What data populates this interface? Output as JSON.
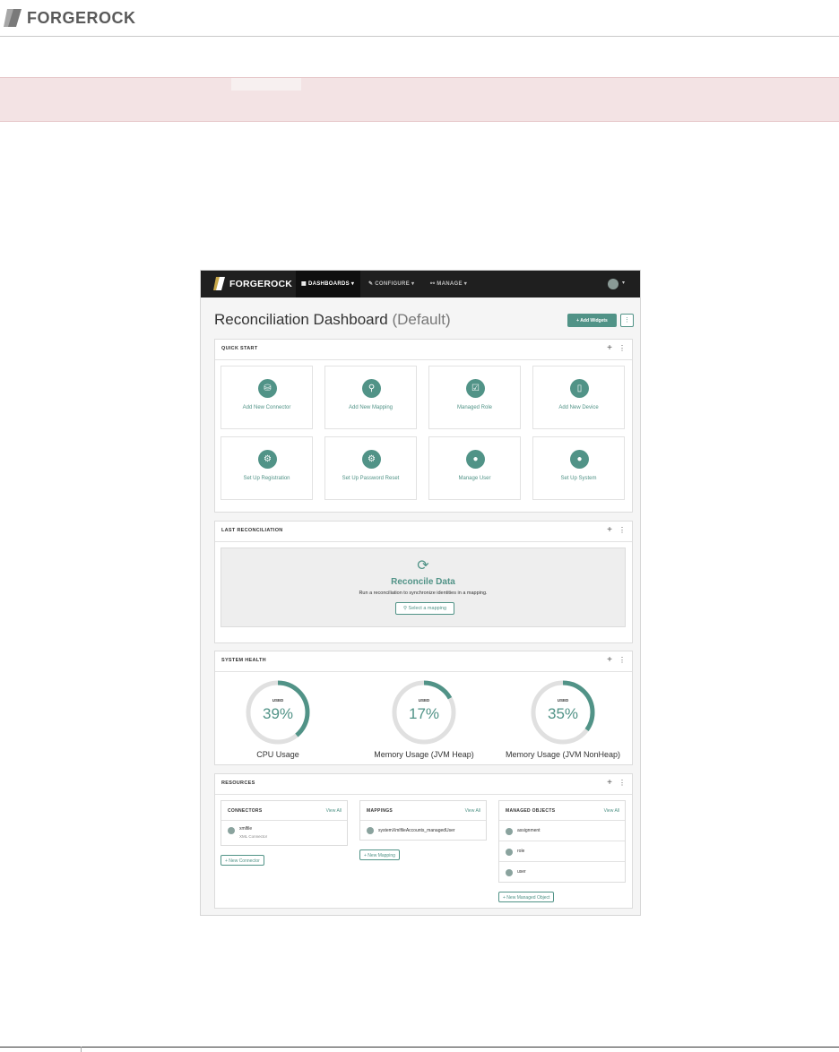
{
  "doc": {
    "logo_text": "FORGEROCK"
  },
  "app": {
    "logo_text": "FORGEROCK",
    "nav": {
      "dashboards": "DASHBOARDS ▾",
      "configure": "CONFIGURE ▾",
      "manage": "MANAGE ▾"
    },
    "user_caret": "▾"
  },
  "dashboard": {
    "title": "Reconciliation Dashboard",
    "title_suffix": "(Default)",
    "add_widgets_label": "+ Add Widgets",
    "more_label": "⋮"
  },
  "quick_start": {
    "title": "QUICK START",
    "items": [
      {
        "label": "Add New Connector",
        "icon": "database-icon",
        "glyph": "⛁"
      },
      {
        "label": "Add New Mapping",
        "icon": "map-pin-icon",
        "glyph": "⚲"
      },
      {
        "label": "Managed Role",
        "icon": "check-square-icon",
        "glyph": "☑"
      },
      {
        "label": "Add New Device",
        "icon": "tablet-icon",
        "glyph": "▯"
      },
      {
        "label": "Set Up Registration",
        "icon": "gear-icon",
        "glyph": "⚙"
      },
      {
        "label": "Set Up Password Reset",
        "icon": "gear-icon",
        "glyph": "⚙"
      },
      {
        "label": "Manage User",
        "icon": "user-icon",
        "glyph": "●"
      },
      {
        "label": "Set Up System",
        "icon": "user-icon",
        "glyph": "●"
      }
    ]
  },
  "last_reconciliation": {
    "title": "LAST RECONCILIATION",
    "heading": "Reconcile Data",
    "description": "Run a reconciliation to synchronize identities in a mapping.",
    "button_label": "⚲  Select a mapping"
  },
  "system_health": {
    "title": "SYSTEM HEALTH",
    "used_label": "USED",
    "gauges": [
      {
        "label": "CPU Usage",
        "percent": 39,
        "value_text": "39%"
      },
      {
        "label": "Memory Usage (JVM Heap)",
        "percent": 17,
        "value_text": "17%"
      },
      {
        "label": "Memory Usage (JVM NonHeap)",
        "percent": 35,
        "value_text": "35%"
      }
    ]
  },
  "resources": {
    "title": "RESOURCES",
    "connectors": {
      "title": "CONNECTORS",
      "view_all": "View All",
      "items": [
        {
          "name": "xmlfile",
          "sub": "XML Connector"
        }
      ],
      "new_label": "+  New Connector"
    },
    "mappings": {
      "title": "MAPPINGS",
      "view_all": "View All",
      "items": [
        {
          "name": "systemXmlfileAccounts_managedUser"
        }
      ],
      "new_label": "+  New Mapping"
    },
    "managed_objects": {
      "title": "MANAGED OBJECTS",
      "view_all": "View All",
      "items": [
        {
          "name": "assignment"
        },
        {
          "name": "role"
        },
        {
          "name": "user"
        }
      ],
      "new_label": "+  New Managed Object"
    }
  },
  "panel_icons": {
    "plus": "+",
    "kebab": "⋮"
  },
  "colors": {
    "accent": "#519387",
    "nav_bg": "#1f1f1f",
    "note_bg": "#f3e3e4"
  }
}
